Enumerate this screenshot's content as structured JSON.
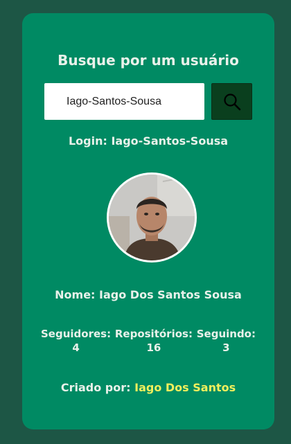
{
  "header": {
    "title": "Busque por um usuário"
  },
  "search": {
    "value": "Iago-Santos-Sousa",
    "button_icon": "search-icon"
  },
  "profile": {
    "login_label": "Login:",
    "login": "Iago-Santos-Sousa",
    "avatar_icon": "avatar",
    "name_label": "Nome:",
    "name": "Iago Dos Santos Sousa"
  },
  "stats": [
    {
      "label": "Seguidores:",
      "value": "4"
    },
    {
      "label": "Repositórios:",
      "value": "16"
    },
    {
      "label": "Seguindo:",
      "value": "3"
    }
  ],
  "footer": {
    "created_label": "Criado por:",
    "author": "Iago Dos Santos",
    "author_color": "#f1ef5c"
  },
  "colors": {
    "background": "#1d5645",
    "card": "#008a63",
    "button": "#0a3f1e",
    "text": "#e9f1ea"
  }
}
